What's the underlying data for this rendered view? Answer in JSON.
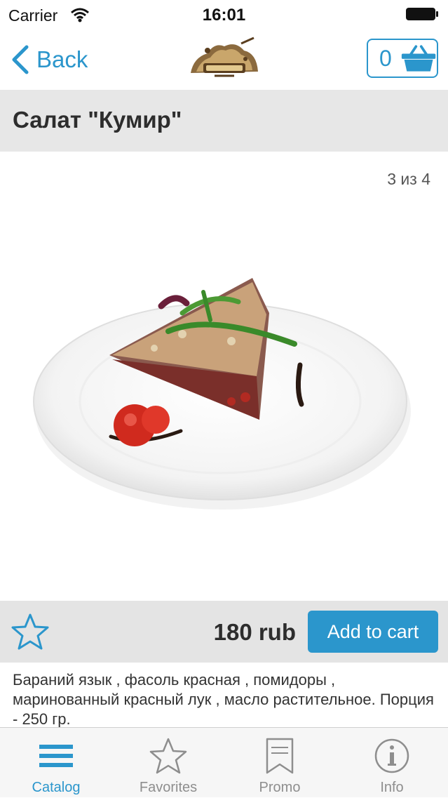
{
  "status_bar": {
    "carrier": "Carrier",
    "time": "16:01"
  },
  "nav": {
    "back_label": "Back",
    "cart_count": "0"
  },
  "product": {
    "title": "Салат \"Кумир\"",
    "gallery_counter": "3 из 4",
    "price": "180 rub",
    "add_to_cart_label": "Add to cart",
    "description": "Бараний язык , фасоль красная , помидоры , маринованный красный лук , масло растительное. Порция - 250 гр."
  },
  "tabs": [
    {
      "label": "Catalog",
      "icon": "menu-icon",
      "active": true
    },
    {
      "label": "Favorites",
      "icon": "star-icon",
      "active": false
    },
    {
      "label": "Promo",
      "icon": "bookmark-icon",
      "active": false
    },
    {
      "label": "Info",
      "icon": "info-icon",
      "active": false
    }
  ],
  "colors": {
    "accent": "#2b96cc",
    "title_bar_bg": "#e7e7e7",
    "action_bar_bg": "#e4e4e4",
    "tab_inactive": "#8e8e8e"
  }
}
